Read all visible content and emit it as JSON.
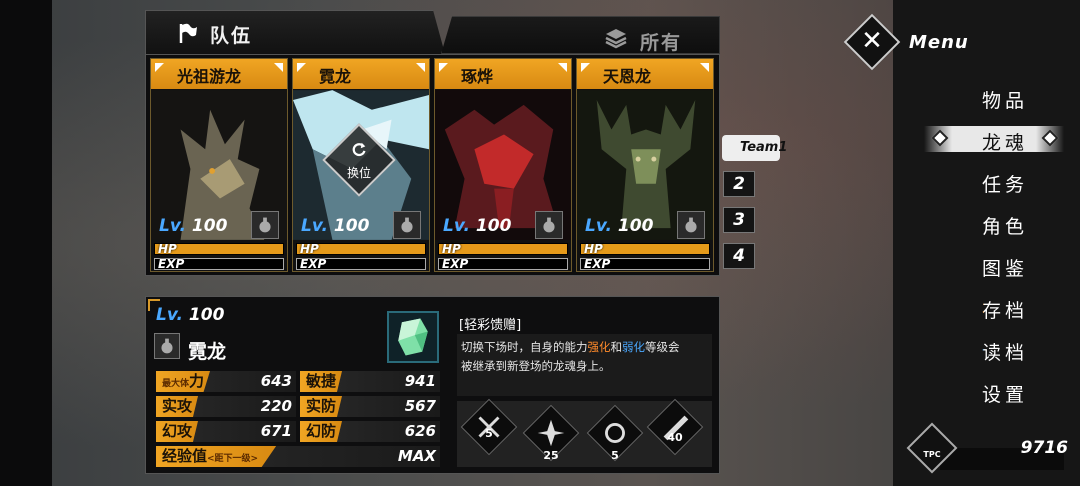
{
  "tabs": {
    "team": "队伍",
    "all": "所有"
  },
  "team_cards": [
    {
      "name": "光祖游龙",
      "lv_prefix": "Lv.",
      "lv_value": "100",
      "hp": "HP",
      "exp": "EXP",
      "hp_fill": 1.0,
      "exp_fill": 0.0,
      "art_color": "#6a6452",
      "accent": "#a89b74"
    },
    {
      "name": "霓龙",
      "lv_prefix": "Lv.",
      "lv_value": "100",
      "hp": "HP",
      "exp": "EXP",
      "hp_fill": 1.0,
      "exp_fill": 0.0,
      "art_color": "#5c7f8c",
      "accent": "#bfe6ef",
      "swap_label": "换位"
    },
    {
      "name": "琢烨",
      "lv_prefix": "Lv.",
      "lv_value": "100",
      "hp": "HP",
      "exp": "EXP",
      "hp_fill": 1.0,
      "exp_fill": 0.0,
      "art_color": "#5a1a1e",
      "accent": "#c22a2a"
    },
    {
      "name": "天恩龙",
      "lv_prefix": "Lv.",
      "lv_value": "100",
      "hp": "HP",
      "exp": "EXP",
      "hp_fill": 1.0,
      "exp_fill": 0.0,
      "art_color": "#3f4a30",
      "accent": "#7e8f5a"
    }
  ],
  "team_tabs": {
    "t1": "Team1",
    "t2": "2",
    "t3": "3",
    "t4": "4"
  },
  "detail": {
    "lv_prefix": "Lv.",
    "lv_value": "100",
    "name": "霓龙",
    "stats": {
      "max_hp_small": "最大体",
      "max_hp_label": "力",
      "max_hp": "643",
      "agility_label": "敏捷",
      "agility": "941",
      "phys_atk_label": "实攻",
      "phys_atk": "220",
      "phys_def_label": "实防",
      "phys_def": "567",
      "illus_atk_label": "幻攻",
      "illus_atk": "671",
      "illus_def_label": "幻防",
      "illus_def": "626",
      "exp_label": "经验值",
      "exp_note": "<距下一级>",
      "exp_value": "MAX"
    },
    "skill": {
      "title": "[轻彩馈赠]",
      "desc_1": "切换下场时，自身的能力",
      "desc_hl1": "强化",
      "desc_2": "和",
      "desc_hl2": "弱化",
      "desc_3": "等级会",
      "desc_line2": "被继承到新登场的龙魂身上。"
    },
    "skills": [
      "5",
      "25",
      "5",
      "40"
    ]
  },
  "menu": {
    "close": "✕",
    "title": "Menu",
    "items": [
      "物品",
      "龙魂",
      "任务",
      "角色",
      "图鉴",
      "存档",
      "读档",
      "设置"
    ],
    "tpc_label": "TPC",
    "tpc_value": "9716"
  },
  "colors": {
    "accent": "#f0a523",
    "lv_blue": "#4aa8ff",
    "hl_orange": "#ff8a2a",
    "hl_blue": "#4aa8ff"
  }
}
